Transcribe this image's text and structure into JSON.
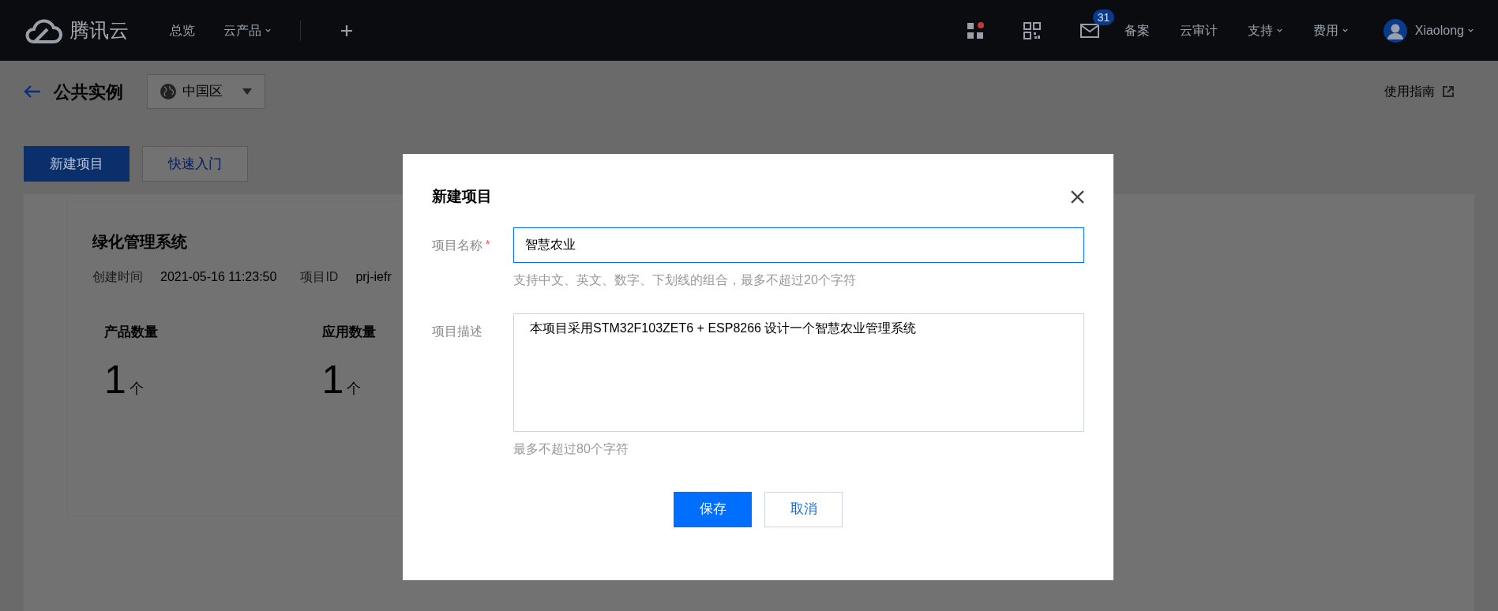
{
  "top_bar": {
    "brand": "腾讯云",
    "nav": [
      {
        "label": "总览",
        "dropdown": false
      },
      {
        "label": "云产品",
        "dropdown": true
      }
    ],
    "apps_dot": true,
    "mail_badge": "31",
    "right_nav": [
      {
        "label": "备案",
        "dropdown": false
      },
      {
        "label": "云审计",
        "dropdown": false
      },
      {
        "label": "支持",
        "dropdown": true
      },
      {
        "label": "费用",
        "dropdown": true
      }
    ],
    "user": {
      "name": "Xiaolong",
      "dropdown": true
    }
  },
  "header": {
    "title": "公共实例",
    "region": "中国区",
    "guide_link": "使用指南"
  },
  "actions": [
    {
      "label": "新建项目",
      "primary": true
    },
    {
      "label": "快速入门",
      "primary": false
    }
  ],
  "project": {
    "name": "绿化管理系统",
    "meta": [
      {
        "label": "创建时间",
        "value": "2021-05-16 11:23:50"
      },
      {
        "label": "项目ID",
        "value": "prj-iefr"
      }
    ],
    "stats": [
      {
        "label": "产品数量",
        "value": "1",
        "unit": "个"
      },
      {
        "label": "应用数量",
        "value": "1",
        "unit": "个"
      }
    ]
  },
  "dialog": {
    "title": "新建项目",
    "fields": [
      {
        "kind": "input",
        "label": "项目名称",
        "required_mark": "*",
        "focused": true,
        "value": "智慧农业",
        "hint": "支持中文、英文、数字、下划线的组合，最多不超过20个字符"
      },
      {
        "kind": "textarea",
        "label": "项目描述",
        "focused": false,
        "value": "本项目采用STM32F103ZET6 + ESP8266 设计一个智慧农业管理系统",
        "hint": "最多不超过80个字符"
      }
    ],
    "buttons": [
      {
        "label": "保存",
        "primary": true
      },
      {
        "label": "取消",
        "primary": false
      }
    ]
  }
}
